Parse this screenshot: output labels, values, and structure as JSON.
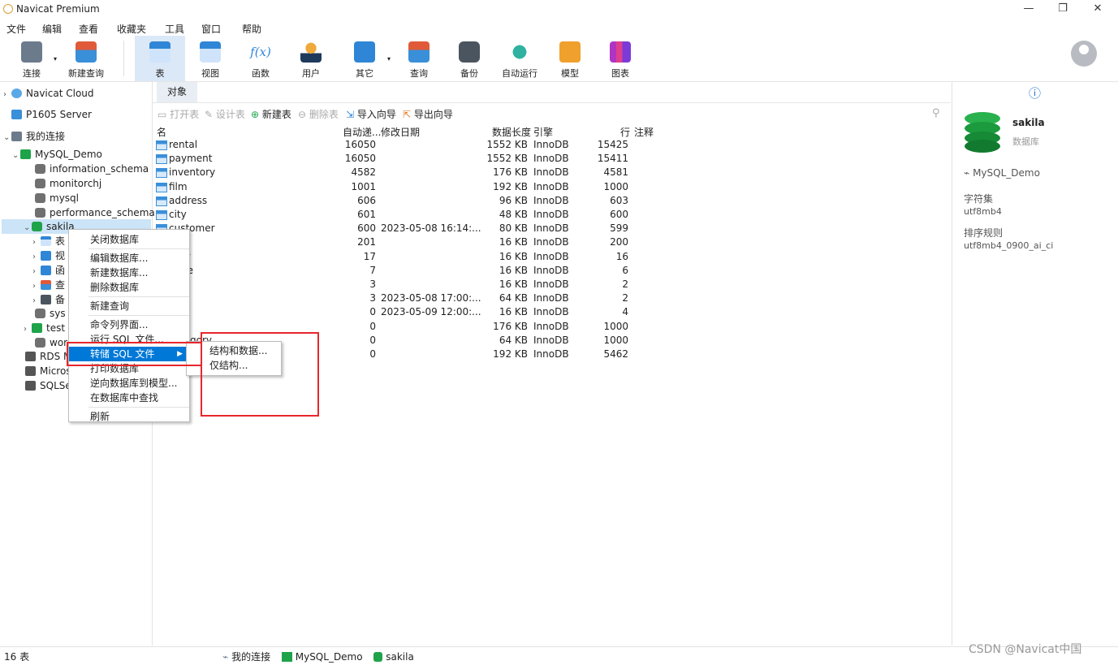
{
  "window": {
    "title": "Navicat Premium",
    "minimize": "—",
    "restore": "❐",
    "close": "✕"
  },
  "menu": [
    "文件",
    "编辑",
    "查看",
    "收藏夹",
    "工具",
    "窗口",
    "帮助"
  ],
  "toolbar": [
    {
      "label": "连接",
      "icon": "plug-icon"
    },
    {
      "label": "新建查询",
      "icon": "new-query-icon"
    },
    {
      "label": "表",
      "icon": "table-icon",
      "active": true
    },
    {
      "label": "视图",
      "icon": "view-icon"
    },
    {
      "label": "函数",
      "icon": "function-icon",
      "glyph": "f(x)"
    },
    {
      "label": "用户",
      "icon": "user-icon"
    },
    {
      "label": "其它",
      "icon": "tools-icon"
    },
    {
      "label": "查询",
      "icon": "query-icon"
    },
    {
      "label": "备份",
      "icon": "backup-icon"
    },
    {
      "label": "自动运行",
      "icon": "robot-icon"
    },
    {
      "label": "模型",
      "icon": "model-icon"
    },
    {
      "label": "图表",
      "icon": "chart-icon"
    }
  ],
  "sidebar": {
    "navicat_cloud": "Navicat Cloud",
    "p1605": "P1605 Server",
    "my_connections": "我的连接",
    "mysql_demo": "MySQL_Demo",
    "dbs": [
      "information_schema",
      "monitorchj",
      "mysql",
      "performance_schema",
      "sakila"
    ],
    "sakila_children": [
      "表",
      "视",
      "函",
      "查",
      "备"
    ],
    "after": [
      "sys",
      "test",
      "wor"
    ],
    "other_conns": [
      "RDS M",
      "Micros",
      "SQLSe"
    ]
  },
  "tabs": {
    "objects": "对象"
  },
  "object_toolbar": {
    "open": "打开表",
    "design": "设计表",
    "new": "新建表",
    "delete": "删除表",
    "import": "导入向导",
    "export": "导出向导",
    "search": "⚲"
  },
  "columns": [
    "名",
    "自动递...",
    "修改日期",
    "数据长度",
    "引擎",
    "行",
    "注释"
  ],
  "rows": [
    {
      "name": "rental",
      "auto": "16050",
      "date": "",
      "size": "1552 KB",
      "engine": "InnoDB",
      "rows": "15425"
    },
    {
      "name": "payment",
      "auto": "16050",
      "date": "",
      "size": "1552 KB",
      "engine": "InnoDB",
      "rows": "15411"
    },
    {
      "name": "inventory",
      "auto": "4582",
      "date": "",
      "size": "176 KB",
      "engine": "InnoDB",
      "rows": "4581"
    },
    {
      "name": "film",
      "auto": "1001",
      "date": "",
      "size": "192 KB",
      "engine": "InnoDB",
      "rows": "1000"
    },
    {
      "name": "address",
      "auto": "606",
      "date": "",
      "size": "96 KB",
      "engine": "InnoDB",
      "rows": "603"
    },
    {
      "name": "city",
      "auto": "601",
      "date": "",
      "size": "48 KB",
      "engine": "InnoDB",
      "rows": "600"
    },
    {
      "name": "customer",
      "auto": "600",
      "date": "2023-05-08 16:14:...",
      "size": "80 KB",
      "engine": "InnoDB",
      "rows": "599"
    },
    {
      "name": "",
      "auto": "201",
      "date": "",
      "size": "16 KB",
      "engine": "InnoDB",
      "rows": "200"
    },
    {
      "name": "gory",
      "auto": "17",
      "date": "",
      "size": "16 KB",
      "engine": "InnoDB",
      "rows": "16"
    },
    {
      "name": "uage",
      "auto": "7",
      "date": "",
      "size": "16 KB",
      "engine": "InnoDB",
      "rows": "6"
    },
    {
      "name": "",
      "auto": "3",
      "date": "",
      "size": "16 KB",
      "engine": "InnoDB",
      "rows": "2"
    },
    {
      "name": "",
      "auto": "3",
      "date": "2023-05-08 17:00:...",
      "size": "64 KB",
      "engine": "InnoDB",
      "rows": "2"
    },
    {
      "name": "",
      "auto": "0",
      "date": "2023-05-09 12:00:...",
      "size": "16 KB",
      "engine": "InnoDB",
      "rows": "4"
    },
    {
      "name": "text",
      "auto": "0",
      "date": "",
      "size": "176 KB",
      "engine": "InnoDB",
      "rows": "1000"
    },
    {
      "name": "category",
      "auto": "0",
      "date": "",
      "size": "64 KB",
      "engine": "InnoDB",
      "rows": "1000"
    },
    {
      "name": "",
      "auto": "0",
      "date": "",
      "size": "192 KB",
      "engine": "InnoDB",
      "rows": "5462"
    }
  ],
  "context_menu": [
    "关闭数据库",
    "编辑数据库...",
    "新建数据库...",
    "删除数据库",
    "新建查询",
    "命令列界面...",
    "运行 SQL 文件...",
    "转储 SQL 文件",
    "打印数据库",
    "逆向数据库到模型...",
    "在数据库中查找",
    "刷新"
  ],
  "submenu": [
    "结构和数据...",
    "仅结构..."
  ],
  "info": {
    "icon": "ⓘ",
    "db_name": "sakila",
    "db_type": "数据库",
    "conn": "MySQL_Demo",
    "charset_label": "字符集",
    "charset": "utf8mb4",
    "collation_label": "排序规则",
    "collation": "utf8mb4_0900_ai_ci"
  },
  "status": {
    "count": "16 表",
    "conn_group": "我的连接",
    "conn": "MySQL_Demo",
    "db": "sakila"
  },
  "watermark": "CSDN @Navicat中国",
  "colors": {
    "accent": "#0078d7",
    "highlight_box": "#e8262c",
    "db_green": "#1fa34a"
  }
}
